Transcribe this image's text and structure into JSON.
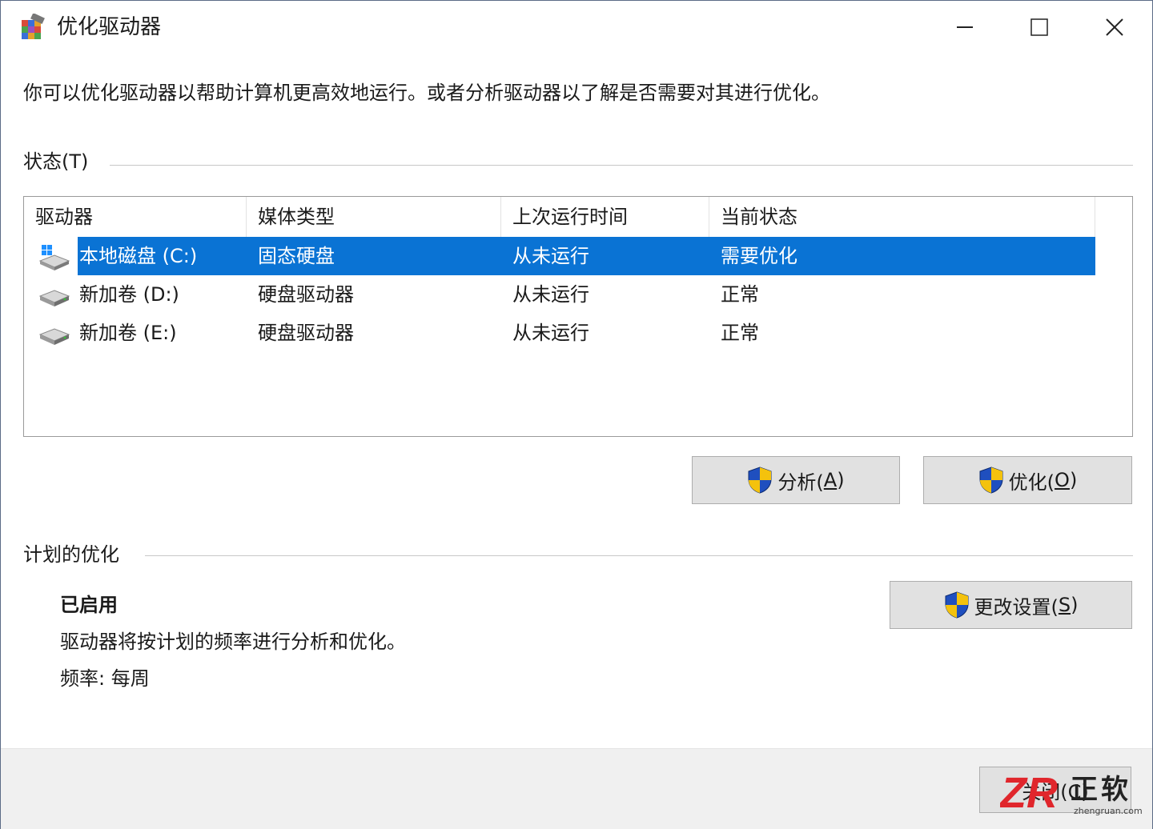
{
  "window": {
    "title": "优化驱动器",
    "controls": {
      "minimize": "minimize-icon",
      "maximize": "maximize-icon",
      "close": "close-icon"
    }
  },
  "intro_text": "你可以优化驱动器以帮助计算机更高效地运行。或者分析驱动器以了解是否需要对其进行优化。",
  "status_group": {
    "label": "状态(T)",
    "columns": [
      "驱动器",
      "媒体类型",
      "上次运行时间",
      "当前状态"
    ],
    "rows": [
      {
        "drive": "本地磁盘 (C:)",
        "media": "固态硬盘",
        "last_run": "从未运行",
        "status": "需要优化",
        "icon": "windows-drive-icon",
        "selected": true
      },
      {
        "drive": "新加卷 (D:)",
        "media": "硬盘驱动器",
        "last_run": "从未运行",
        "status": "正常",
        "icon": "hard-drive-icon",
        "selected": false
      },
      {
        "drive": "新加卷 (E:)",
        "media": "硬盘驱动器",
        "last_run": "从未运行",
        "status": "正常",
        "icon": "hard-drive-icon",
        "selected": false
      }
    ],
    "analyze_button": {
      "label": "分析(",
      "key": "A",
      "suffix": ")"
    },
    "optimize_button": {
      "label": "优化(",
      "key": "O",
      "suffix": ")"
    }
  },
  "schedule_group": {
    "label": "计划的优化",
    "state": "已启用",
    "description": "驱动器将按计划的频率进行分析和优化。",
    "frequency": "频率: 每周",
    "change_settings_button": {
      "label": "更改设置(",
      "key": "S",
      "suffix": ")"
    }
  },
  "footer": {
    "close_button_label": "关闭(C)"
  },
  "watermark": {
    "logo": "ZR",
    "text": "正软",
    "url": "zhengruan.com"
  },
  "colors": {
    "selection": "#0a73d4",
    "button_face": "#e1e1e1",
    "footer_bg": "#f0f0f0"
  }
}
